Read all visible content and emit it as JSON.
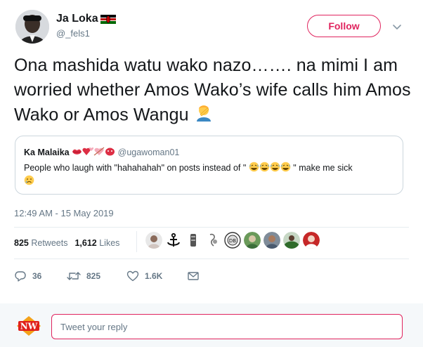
{
  "author": {
    "name": "Ja Loka",
    "handle": "@_fels1",
    "flag_icon": "kenya-flag-icon",
    "avatar_icon": "user-avatar"
  },
  "follow_label": "Follow",
  "tweet": {
    "text": "Ona mashida watu wako nazo……. na mimi I am worried whether Amos Wako’s wife calls him Amos Wako or Amos Wangu",
    "trailing_emoji": "person-facepalming-icon"
  },
  "quoted": {
    "name": "Ka Malaika",
    "name_emojis": [
      "kiss-mark-icon",
      "revolving-hearts-icon",
      "heart-arrow-icon",
      "ogre-icon"
    ],
    "handle": "@ugawoman01",
    "text_before": "People who laugh with \"hahahahah\" on posts instead of \"",
    "text_emojis": [
      "tears-of-joy-icon",
      "tears-of-joy-icon",
      "tears-of-joy-icon",
      "tears-of-joy-icon"
    ],
    "text_after": "\" make me sick",
    "trailing_emoji": "crying-face-icon"
  },
  "timestamp": "12:49 AM - 15 May 2019",
  "stats": {
    "retweets_count": "825",
    "retweets_label": "Retweets",
    "likes_count": "1,612",
    "likes_label": "Likes"
  },
  "actions": {
    "reply_count": "36",
    "retweet_count": "825",
    "like_count": "1.6K"
  },
  "reply": {
    "placeholder": "Tweet your reply",
    "logo_text": "NW"
  },
  "colors": {
    "accent": "#e0245e",
    "muted": "#657786",
    "text": "#14171a",
    "border": "#e6ecf0"
  }
}
